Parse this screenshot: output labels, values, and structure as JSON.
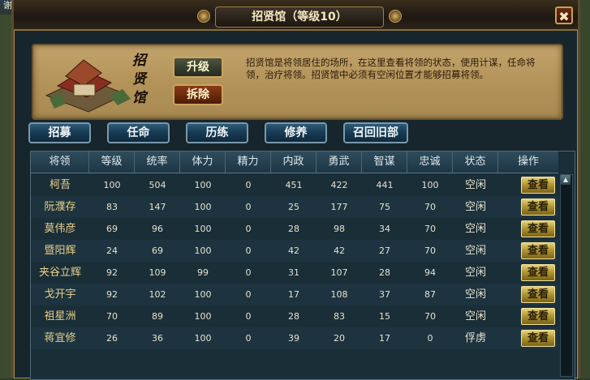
{
  "background": {
    "corner_text": "谢宣麾家内"
  },
  "window": {
    "title": "招贤馆（等级10）",
    "close_label": "✖"
  },
  "building": {
    "sign": "招贤馆",
    "upgrade_label": "升级",
    "demolish_label": "拆除",
    "description": "招贤馆是将领居住的场所，在这里查看将领的状态，使用计谋，任命将领，治疗将领。招贤馆中必须有空闲位置才能够招募将领。"
  },
  "actions": [
    {
      "label": "招募"
    },
    {
      "label": "任命"
    },
    {
      "label": "历练"
    },
    {
      "label": "修养"
    },
    {
      "label": "召回旧部"
    }
  ],
  "table": {
    "headers": [
      "将领",
      "等级",
      "统率",
      "体力",
      "精力",
      "内政",
      "勇武",
      "智谋",
      "忠诚",
      "状态",
      "操作"
    ],
    "view_label": "查看",
    "rows": [
      {
        "name": "柯吾",
        "level": "100",
        "command": "504",
        "stamina": "100",
        "energy": "0",
        "politics": "451",
        "valor": "422",
        "wisdom": "441",
        "loyalty": "100",
        "status": "空闲"
      },
      {
        "name": "阮濮存",
        "level": "83",
        "command": "147",
        "stamina": "100",
        "energy": "0",
        "politics": "25",
        "valor": "177",
        "wisdom": "75",
        "loyalty": "70",
        "status": "空闲"
      },
      {
        "name": "莫伟彦",
        "level": "69",
        "command": "96",
        "stamina": "100",
        "energy": "0",
        "politics": "28",
        "valor": "98",
        "wisdom": "34",
        "loyalty": "70",
        "status": "空闲"
      },
      {
        "name": "暨阳辉",
        "level": "24",
        "command": "69",
        "stamina": "100",
        "energy": "0",
        "politics": "42",
        "valor": "42",
        "wisdom": "27",
        "loyalty": "70",
        "status": "空闲"
      },
      {
        "name": "夹谷立辉",
        "level": "92",
        "command": "109",
        "stamina": "99",
        "energy": "0",
        "politics": "31",
        "valor": "107",
        "wisdom": "28",
        "loyalty": "94",
        "status": "空闲"
      },
      {
        "name": "戈开宇",
        "level": "92",
        "command": "102",
        "stamina": "100",
        "energy": "0",
        "politics": "17",
        "valor": "108",
        "wisdom": "37",
        "loyalty": "87",
        "status": "空闲"
      },
      {
        "name": "祖星洲",
        "level": "70",
        "command": "89",
        "stamina": "100",
        "energy": "0",
        "politics": "28",
        "valor": "83",
        "wisdom": "15",
        "loyalty": "70",
        "status": "空闲"
      },
      {
        "name": "蒋宜修",
        "level": "26",
        "command": "36",
        "stamina": "100",
        "energy": "0",
        "politics": "39",
        "valor": "20",
        "wisdom": "17",
        "loyalty": "0",
        "status": "俘虏"
      }
    ]
  },
  "colors": {
    "accent_gold": "#c9a55c",
    "name_text": "#e9d08a",
    "panel_bg": "#1a2e38",
    "button_blue": "#173a52"
  },
  "icons": {
    "close": "close-icon",
    "scroll_up": "scroll-up-arrow-icon"
  }
}
